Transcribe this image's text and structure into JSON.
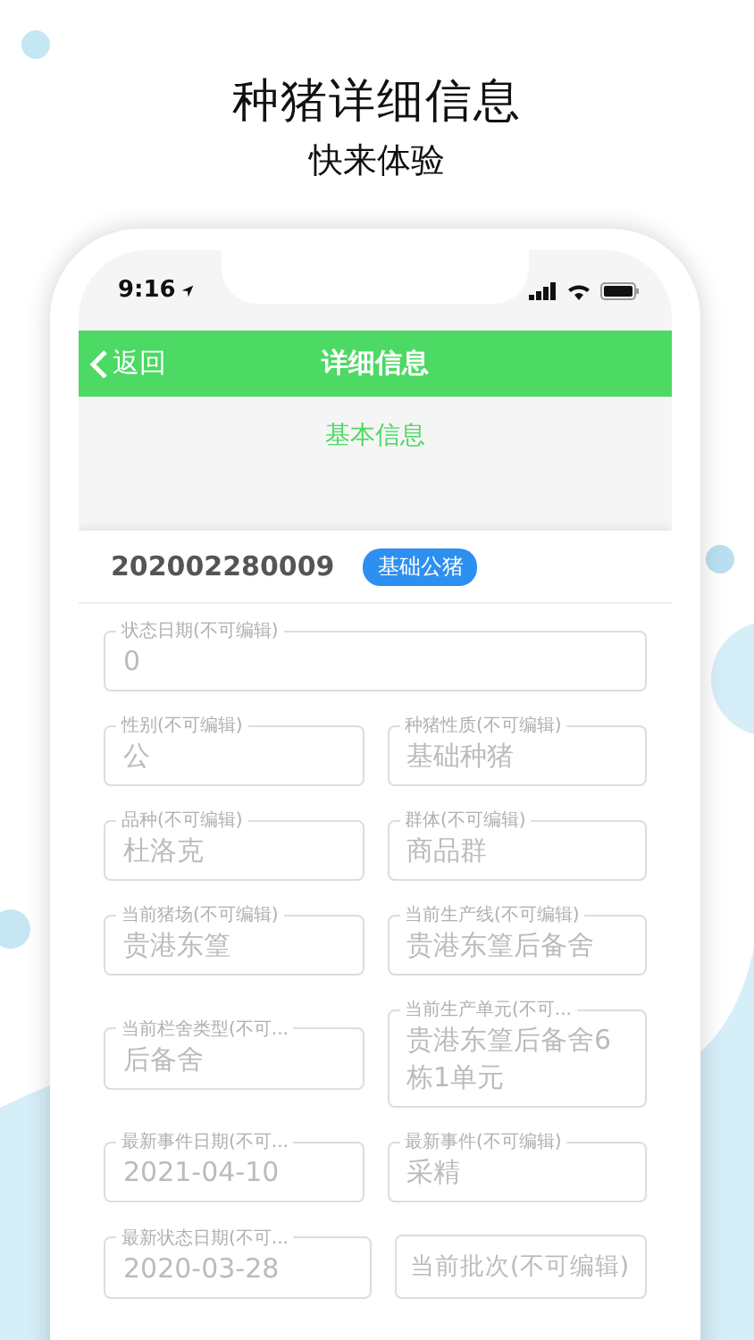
{
  "promo": {
    "title": "种猪详细信息",
    "subtitle": "快来体验"
  },
  "status_bar": {
    "time": "9:16"
  },
  "nav_bar": {
    "back": "返回",
    "title": "详细信息"
  },
  "section_tab": {
    "label": "基本信息"
  },
  "pig": {
    "id": "202002280009",
    "tag": "基础公猪"
  },
  "field_rows": [
    {
      "fields": [
        {
          "label": "状态日期(不可编辑)",
          "value": "0"
        }
      ]
    },
    {
      "fields": [
        {
          "label": "性别(不可编辑)",
          "value": "公"
        },
        {
          "label": "种猪性质(不可编辑)",
          "value": "基础种猪"
        }
      ]
    },
    {
      "fields": [
        {
          "label": "品种(不可编辑)",
          "value": "杜洛克"
        },
        {
          "label": "群体(不可编辑)",
          "value": "商品群"
        }
      ]
    },
    {
      "fields": [
        {
          "label": "当前猪场(不可编辑)",
          "value": "贵港东篁"
        },
        {
          "label": "当前生产线(不可编辑)",
          "value": "贵港东篁后备舍"
        }
      ]
    },
    {
      "fields": [
        {
          "label": "当前栏舍类型(不可...",
          "value": "后备舍"
        },
        {
          "label": "当前生产单元(不可...",
          "value": "贵港东篁后备舍6栋1单元"
        }
      ]
    },
    {
      "fields": [
        {
          "label": "最新事件日期(不可...",
          "value": "2021-04-10"
        },
        {
          "label": "最新事件(不可编辑)",
          "value": "采精"
        }
      ]
    },
    {
      "fields": [
        {
          "label": "最新状态日期(不可...",
          "value": "2020-03-28"
        },
        {
          "placeholder": "当前批次(不可编辑)"
        }
      ]
    }
  ]
}
